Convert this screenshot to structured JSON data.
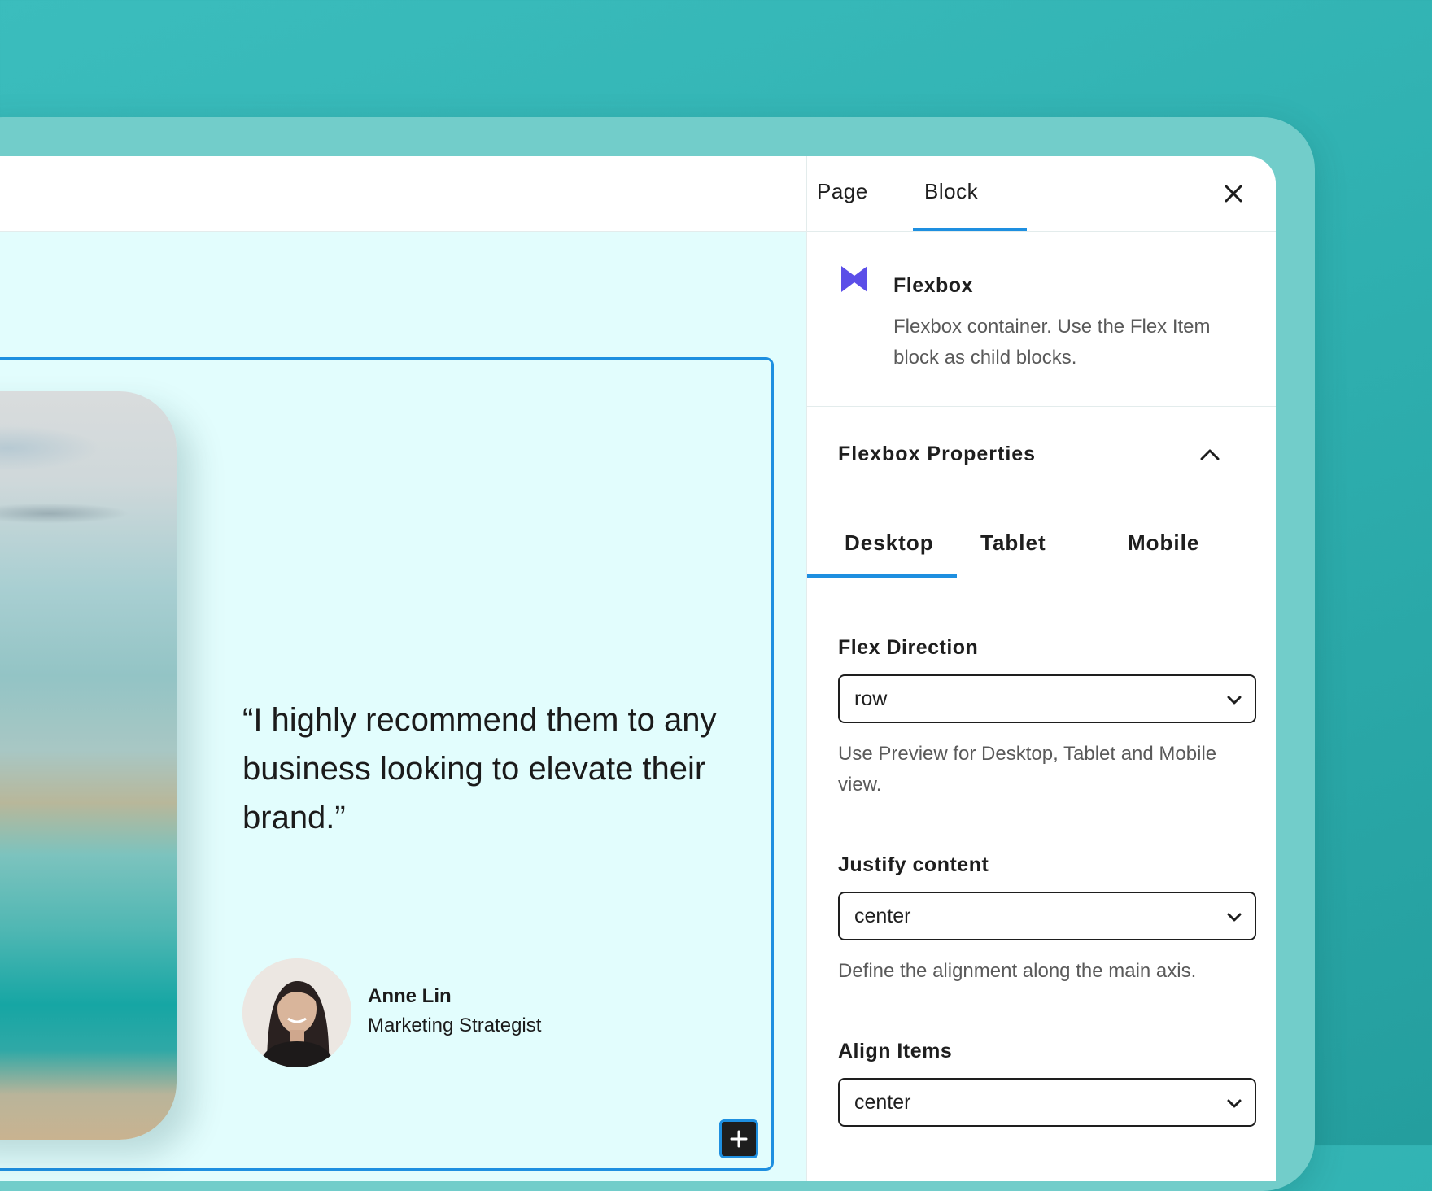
{
  "colors": {
    "accent": "#1e8fe0",
    "canvas_bg": "#e2fdfd",
    "block_icon": "#5b4ee8",
    "teal_bg": "#2fb0b0"
  },
  "sidebar": {
    "tabs": [
      {
        "label": "Page"
      },
      {
        "label": "Block",
        "active": true
      }
    ],
    "block": {
      "icon": "flexbox-icon",
      "title": "Flexbox",
      "description": "Flexbox container. Use the Flex Item block as child blocks."
    },
    "panel": {
      "title": "Flexbox Properties",
      "expanded": true,
      "device_tabs": [
        {
          "label": "Desktop",
          "active": true
        },
        {
          "label": "Tablet"
        },
        {
          "label": "Mobile"
        }
      ],
      "fields": {
        "flex_direction": {
          "label": "Flex Direction",
          "value": "row",
          "help": "Use Preview for Desktop, Tablet and Mobile view."
        },
        "justify_content": {
          "label": "Justify content",
          "value": "center",
          "help": "Define the alignment along the main axis."
        },
        "align_items": {
          "label": "Align Items",
          "value": "center"
        }
      }
    }
  },
  "canvas": {
    "quote": "“I highly recommend them to any business looking to elevate their brand.”",
    "author": {
      "name": "Anne Lin",
      "title": "Marketing Strategist"
    },
    "add_block_icon": "plus-icon"
  }
}
